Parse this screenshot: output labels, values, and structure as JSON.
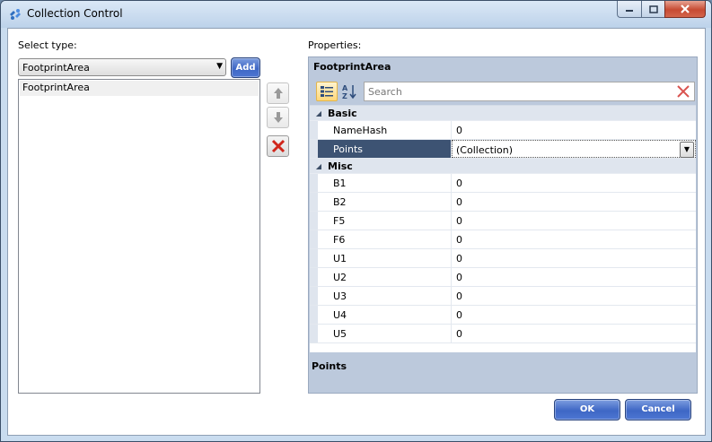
{
  "window": {
    "title": "Collection Control"
  },
  "left": {
    "select_label": "Select type:",
    "selected_type": "FootprintArea",
    "add_label": "Add",
    "items": [
      "FootprintArea"
    ]
  },
  "properties": {
    "label": "Properties:",
    "object_name": "FootprintArea",
    "search_placeholder": "Search",
    "categories": [
      {
        "name": "Basic",
        "rows": [
          {
            "name": "NameHash",
            "value": "0"
          },
          {
            "name": "Points",
            "value": "(Collection)",
            "selected": true
          }
        ]
      },
      {
        "name": "Misc",
        "rows": [
          {
            "name": "B1",
            "value": "0"
          },
          {
            "name": "B2",
            "value": "0"
          },
          {
            "name": "F5",
            "value": "0"
          },
          {
            "name": "F6",
            "value": "0"
          },
          {
            "name": "U1",
            "value": "0"
          },
          {
            "name": "U2",
            "value": "0"
          },
          {
            "name": "U3",
            "value": "0"
          },
          {
            "name": "U4",
            "value": "0"
          },
          {
            "name": "U5",
            "value": "0"
          }
        ]
      }
    ],
    "description_title": "Points"
  },
  "buttons": {
    "ok": "OK",
    "cancel": "Cancel"
  },
  "colors": {
    "accent": "#3e67c5",
    "selected_row": "#3d5373",
    "delete_red": "#d0261b"
  }
}
